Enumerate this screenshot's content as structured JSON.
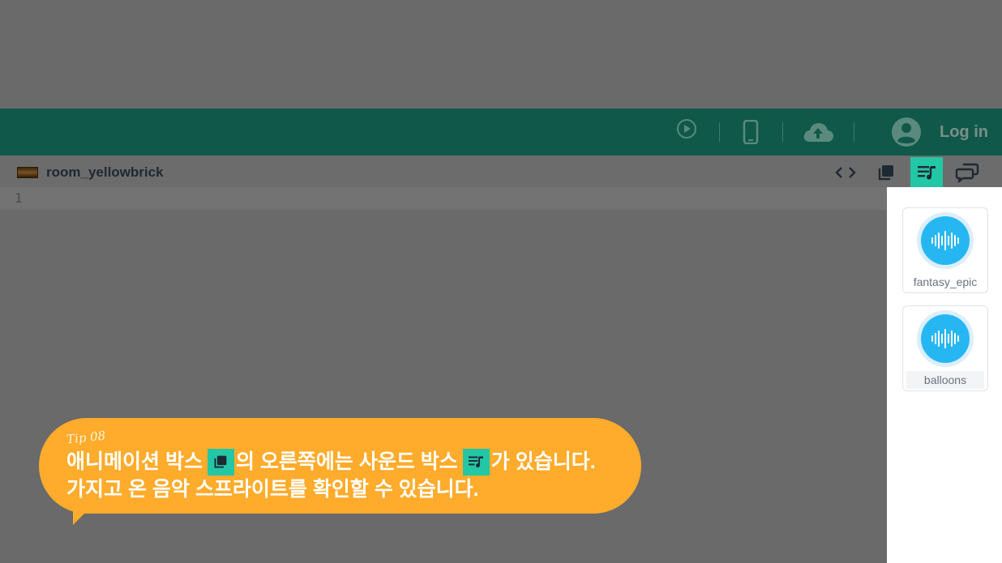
{
  "topbar": {
    "login_label": "Log in",
    "icons": [
      "play-icon",
      "phone-icon",
      "cloud-upload-icon",
      "account-icon"
    ]
  },
  "tabbar": {
    "scene_name": "room_yellowbrick",
    "tabs": [
      "code-icon",
      "sprite-box-icon",
      "sound-box-icon",
      "chat-icon"
    ],
    "active_tab": "sound-box-icon"
  },
  "editor": {
    "line_number": "1"
  },
  "sound_panel": {
    "items": [
      {
        "label": "fantasy_epic"
      },
      {
        "label": "balloons"
      }
    ]
  },
  "tip": {
    "label": "Tip 08",
    "line1_part1": "애니메이션 박스",
    "line1_part2": "의 오른쪽에는 사운드 박스",
    "line1_part3": "가 있습니다.",
    "line2": "가지고 온 음악 스프라이트를 확인할 수 있습니다."
  },
  "colors": {
    "topbar": "#10594a",
    "accent": "#22c7a5",
    "bubble": "#ffab2b",
    "sound_circle": "#26b7f3"
  }
}
